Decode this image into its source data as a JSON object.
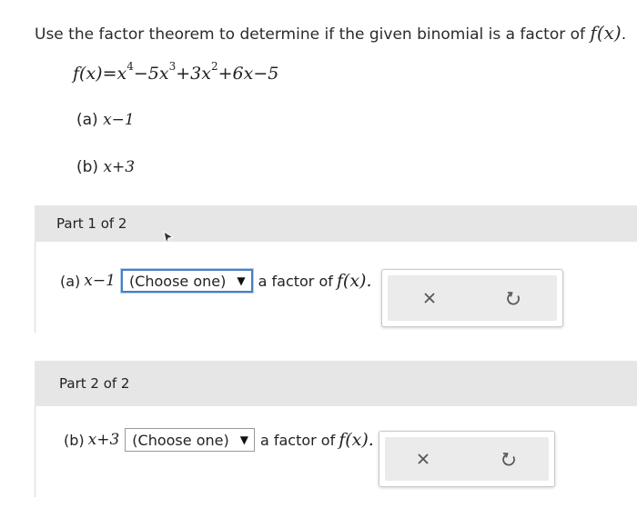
{
  "question": {
    "instruction": "Use the factor theorem to determine if the given binomial is a factor of",
    "func_name": "f(x)",
    "period": "."
  },
  "function": {
    "lhs": "f(x)",
    "equals": "=",
    "t1_base": "x",
    "t1_exp": "4",
    "t2": "−5x",
    "t2_exp": "3",
    "t3": "+3x",
    "t3_exp": "2",
    "t4": "+6x−5"
  },
  "subquestions": {
    "a_label": "(a)",
    "a_expr": "x−1",
    "b_label": "(b)",
    "b_expr": "x+3"
  },
  "part1": {
    "header": "Part 1 of 2",
    "prefix": "(a)",
    "expr": "x−1",
    "select_value": "(Choose one)",
    "suffix": "a factor of",
    "func": "f(x)."
  },
  "part2": {
    "header": "Part 2 of 2",
    "prefix": "(b)",
    "expr": "x+3",
    "select_value": "(Choose one)",
    "suffix": "a factor of",
    "func": "f(x)."
  },
  "colors": {
    "header_bg": "#e6e6e6",
    "focus_border": "#4a7fc4",
    "icon_gray": "#555555"
  }
}
